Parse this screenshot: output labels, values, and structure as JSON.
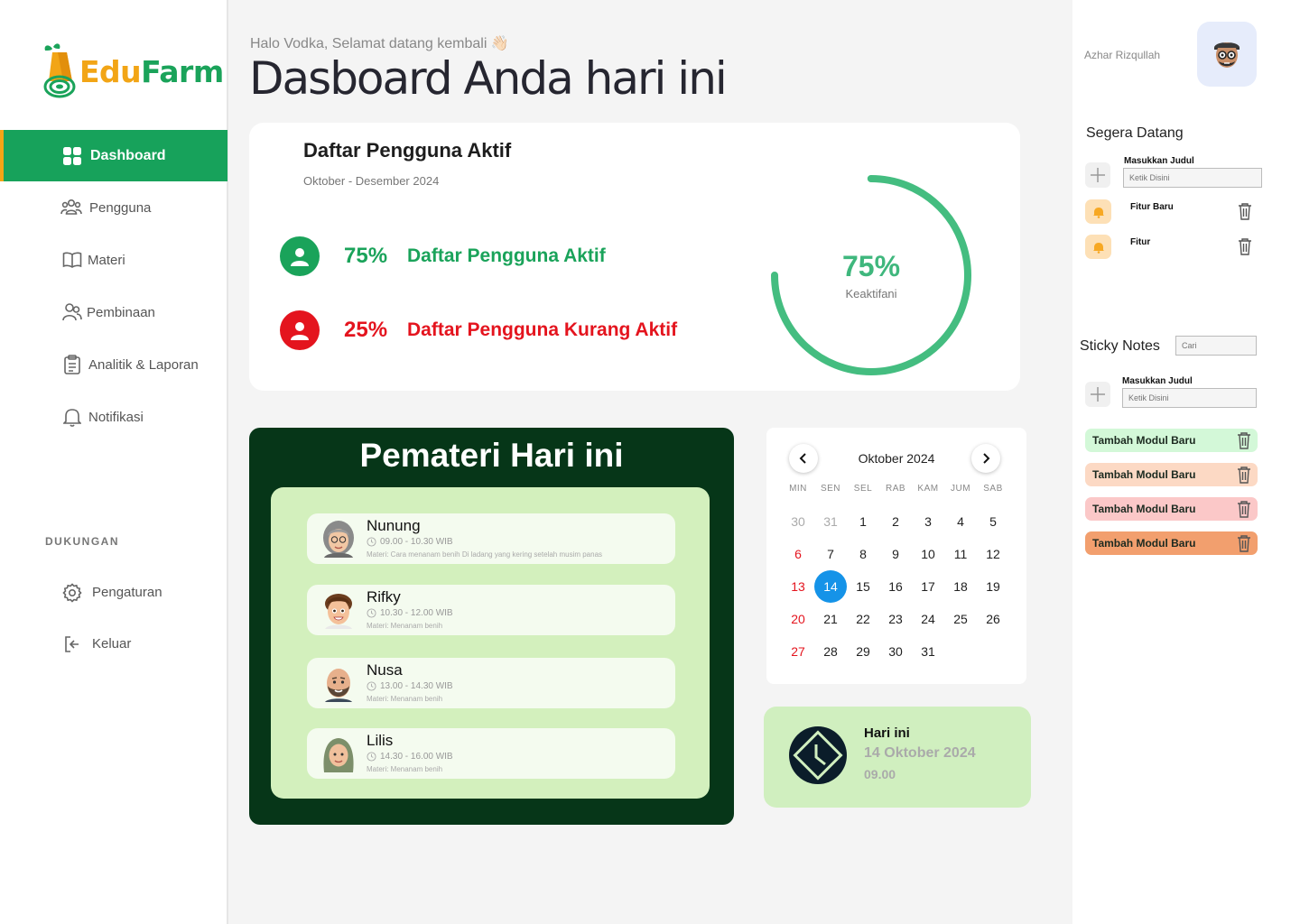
{
  "brand": {
    "edu": "Edu",
    "farm": "Farm"
  },
  "sidebar": {
    "items": [
      {
        "label": "Dashboard",
        "icon": "grid-icon"
      },
      {
        "label": "Pengguna",
        "icon": "users-icon"
      },
      {
        "label": "Materi",
        "icon": "book-icon"
      },
      {
        "label": "Pembinaan",
        "icon": "mentoring-icon"
      },
      {
        "label": "Analitik & Laporan",
        "icon": "clipboard-icon"
      },
      {
        "label": "Notifikasi",
        "icon": "bell-icon"
      }
    ],
    "support_label": "DUKUNGAN",
    "support_items": [
      {
        "label": "Pengaturan",
        "icon": "gear-icon"
      },
      {
        "label": "Keluar",
        "icon": "logout-icon"
      }
    ]
  },
  "header": {
    "greeting": "Halo Vodka, Selamat datang kembali 👋🏻",
    "title": "Dasboard Anda hari ini"
  },
  "active_users": {
    "title": "Daftar Pengguna Aktif",
    "period": "Oktober - Desember 2024",
    "active_pct": "75%",
    "active_label": "Daftar Pengguna Aktif",
    "inactive_pct": "25%",
    "inactive_label": "Daftar Pengguna Kurang Aktif",
    "donut_value": "75%",
    "donut_label": "Keaktifani",
    "donut_fraction": 0.75,
    "colors": {
      "active": "#1aa35a",
      "inactive": "#e4141e",
      "ring_active": "#44bd80"
    }
  },
  "speakers": {
    "title": "Pemateri Hari ini",
    "items": [
      {
        "name": "Nunung",
        "time": "09.00 - 10.30 WIB",
        "materi": "Materi: Cara menanam benih Di ladang yang kering setelah musim panas"
      },
      {
        "name": "Rifky",
        "time": "10.30 - 12.00 WIB",
        "materi": "Materi: Menanam benih"
      },
      {
        "name": "Nusa",
        "time": "13.00 - 14.30 WIB",
        "materi": "Materi: Menanam benih"
      },
      {
        "name": "Lilis",
        "time": "14.30 - 16.00 WIB",
        "materi": "Materi: Menanam benih"
      }
    ]
  },
  "calendar": {
    "month": "Oktober 2024",
    "dow": [
      "MIN",
      "SEN",
      "SEL",
      "RAB",
      "KAM",
      "JUM",
      "SAB"
    ],
    "days": [
      "30",
      "31",
      "1",
      "2",
      "3",
      "4",
      "5",
      "6",
      "7",
      "8",
      "9",
      "10",
      "11",
      "12",
      "13",
      "14",
      "15",
      "16",
      "17",
      "18",
      "19",
      "20",
      "21",
      "22",
      "23",
      "24",
      "25",
      "26",
      "27",
      "28",
      "29",
      "30",
      "31"
    ],
    "today": "14"
  },
  "today_card": {
    "label": "Hari ini",
    "date": "14 Oktober 2024",
    "time": "09.00"
  },
  "user": {
    "name": "Azhar Rizqullah"
  },
  "coming_soon": {
    "title": "Segera Datang",
    "input_label": "Masukkan Judul",
    "input_placeholder": "Ketik Disini",
    "items": [
      "Fitur Baru",
      "Fitur"
    ]
  },
  "sticky_notes": {
    "title": "Sticky Notes",
    "search_placeholder": "Cari",
    "input_label": "Masukkan Judul",
    "input_placeholder": "Ketik Disini",
    "notes": [
      {
        "label": "Tambah Modul Baru",
        "color": "#d3f8d8"
      },
      {
        "label": "Tambah Modul Baru",
        "color": "#fcd9c4"
      },
      {
        "label": "Tambah Modul Baru",
        "color": "#fbc8c8"
      },
      {
        "label": "Tambah Modul Baru",
        "color": "#f29f6e"
      }
    ]
  }
}
